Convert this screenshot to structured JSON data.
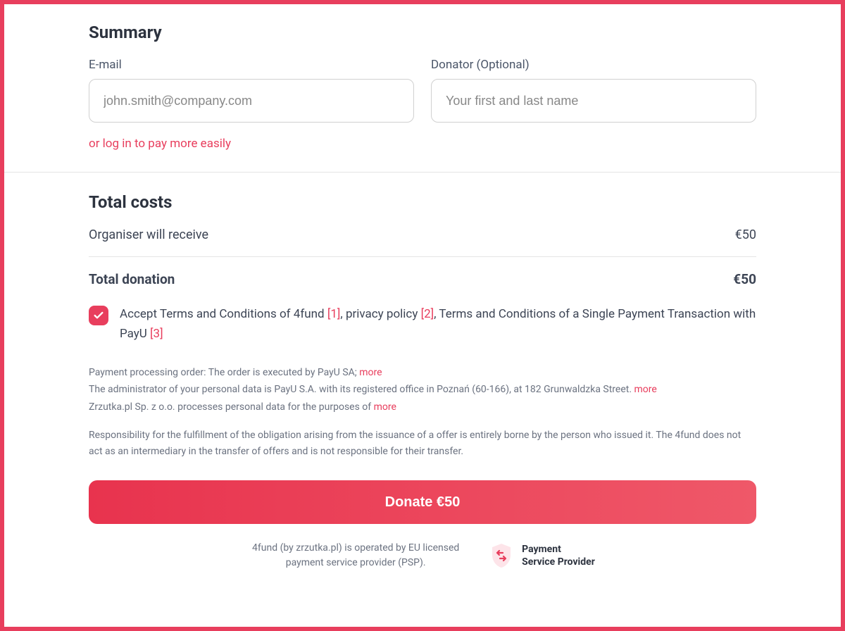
{
  "summary": {
    "heading": "Summary",
    "email_label": "E-mail",
    "email_placeholder": "john.smith@company.com",
    "donator_label": "Donator (Optional)",
    "donator_placeholder": "Your first and last name",
    "login_link": "or log in to pay more easily"
  },
  "costs": {
    "heading": "Total costs",
    "organiser_label": "Organiser will receive",
    "organiser_amount": "€50",
    "total_label": "Total donation",
    "total_amount": "€50"
  },
  "terms": {
    "text_part1": "Accept Terms and Conditions of 4fund ",
    "ref1": "[1]",
    "text_part2": ", privacy policy ",
    "ref2": "[2]",
    "text_part3": ", Terms and Conditions of a Single Payment Transaction with PayU ",
    "ref3": "[3]"
  },
  "fine": {
    "line1": "Payment processing order: The order is executed by PayU SA; ",
    "line2": "The administrator of your personal data is PayU S.A. with its registered office in Poznań (60-166), at 182 Grunwaldzka Street. ",
    "line3": "Zrzutka.pl Sp. z o.o. processes personal data for the purposes of ",
    "more": "more",
    "responsibility": "Responsibility for the fulfillment of the obligation arising from the issuance of a offer is entirely borne by the person who issued it. The 4fund does not act as an intermediary in the transfer of offers and is not responsible for their transfer."
  },
  "donate_button": "Donate €50",
  "footer": {
    "operated_by": "4fund (by zrzutka.pl) is operated by EU licensed payment service provider (PSP).",
    "psp_line1": "Payment",
    "psp_line2": "Service Provider"
  }
}
